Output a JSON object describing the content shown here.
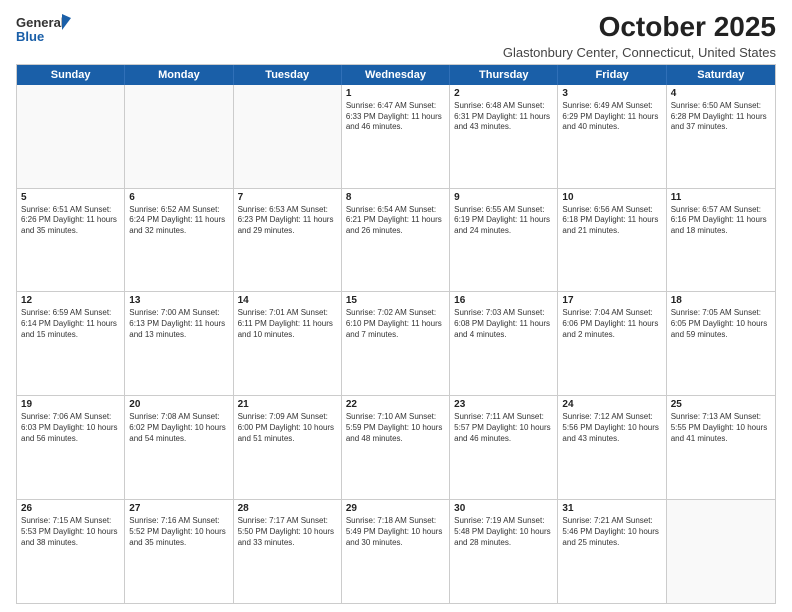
{
  "header": {
    "logo_general": "General",
    "logo_blue": "Blue",
    "month_title": "October 2025",
    "location": "Glastonbury Center, Connecticut, United States"
  },
  "days_of_week": [
    "Sunday",
    "Monday",
    "Tuesday",
    "Wednesday",
    "Thursday",
    "Friday",
    "Saturday"
  ],
  "weeks": [
    [
      {
        "day": "",
        "empty": true
      },
      {
        "day": "",
        "empty": true
      },
      {
        "day": "",
        "empty": true
      },
      {
        "day": "1",
        "info": "Sunrise: 6:47 AM\nSunset: 6:33 PM\nDaylight: 11 hours\nand 46 minutes."
      },
      {
        "day": "2",
        "info": "Sunrise: 6:48 AM\nSunset: 6:31 PM\nDaylight: 11 hours\nand 43 minutes."
      },
      {
        "day": "3",
        "info": "Sunrise: 6:49 AM\nSunset: 6:29 PM\nDaylight: 11 hours\nand 40 minutes."
      },
      {
        "day": "4",
        "info": "Sunrise: 6:50 AM\nSunset: 6:28 PM\nDaylight: 11 hours\nand 37 minutes."
      }
    ],
    [
      {
        "day": "5",
        "info": "Sunrise: 6:51 AM\nSunset: 6:26 PM\nDaylight: 11 hours\nand 35 minutes."
      },
      {
        "day": "6",
        "info": "Sunrise: 6:52 AM\nSunset: 6:24 PM\nDaylight: 11 hours\nand 32 minutes."
      },
      {
        "day": "7",
        "info": "Sunrise: 6:53 AM\nSunset: 6:23 PM\nDaylight: 11 hours\nand 29 minutes."
      },
      {
        "day": "8",
        "info": "Sunrise: 6:54 AM\nSunset: 6:21 PM\nDaylight: 11 hours\nand 26 minutes."
      },
      {
        "day": "9",
        "info": "Sunrise: 6:55 AM\nSunset: 6:19 PM\nDaylight: 11 hours\nand 24 minutes."
      },
      {
        "day": "10",
        "info": "Sunrise: 6:56 AM\nSunset: 6:18 PM\nDaylight: 11 hours\nand 21 minutes."
      },
      {
        "day": "11",
        "info": "Sunrise: 6:57 AM\nSunset: 6:16 PM\nDaylight: 11 hours\nand 18 minutes."
      }
    ],
    [
      {
        "day": "12",
        "info": "Sunrise: 6:59 AM\nSunset: 6:14 PM\nDaylight: 11 hours\nand 15 minutes."
      },
      {
        "day": "13",
        "info": "Sunrise: 7:00 AM\nSunset: 6:13 PM\nDaylight: 11 hours\nand 13 minutes."
      },
      {
        "day": "14",
        "info": "Sunrise: 7:01 AM\nSunset: 6:11 PM\nDaylight: 11 hours\nand 10 minutes."
      },
      {
        "day": "15",
        "info": "Sunrise: 7:02 AM\nSunset: 6:10 PM\nDaylight: 11 hours\nand 7 minutes."
      },
      {
        "day": "16",
        "info": "Sunrise: 7:03 AM\nSunset: 6:08 PM\nDaylight: 11 hours\nand 4 minutes."
      },
      {
        "day": "17",
        "info": "Sunrise: 7:04 AM\nSunset: 6:06 PM\nDaylight: 11 hours\nand 2 minutes."
      },
      {
        "day": "18",
        "info": "Sunrise: 7:05 AM\nSunset: 6:05 PM\nDaylight: 10 hours\nand 59 minutes."
      }
    ],
    [
      {
        "day": "19",
        "info": "Sunrise: 7:06 AM\nSunset: 6:03 PM\nDaylight: 10 hours\nand 56 minutes."
      },
      {
        "day": "20",
        "info": "Sunrise: 7:08 AM\nSunset: 6:02 PM\nDaylight: 10 hours\nand 54 minutes."
      },
      {
        "day": "21",
        "info": "Sunrise: 7:09 AM\nSunset: 6:00 PM\nDaylight: 10 hours\nand 51 minutes."
      },
      {
        "day": "22",
        "info": "Sunrise: 7:10 AM\nSunset: 5:59 PM\nDaylight: 10 hours\nand 48 minutes."
      },
      {
        "day": "23",
        "info": "Sunrise: 7:11 AM\nSunset: 5:57 PM\nDaylight: 10 hours\nand 46 minutes."
      },
      {
        "day": "24",
        "info": "Sunrise: 7:12 AM\nSunset: 5:56 PM\nDaylight: 10 hours\nand 43 minutes."
      },
      {
        "day": "25",
        "info": "Sunrise: 7:13 AM\nSunset: 5:55 PM\nDaylight: 10 hours\nand 41 minutes."
      }
    ],
    [
      {
        "day": "26",
        "info": "Sunrise: 7:15 AM\nSunset: 5:53 PM\nDaylight: 10 hours\nand 38 minutes."
      },
      {
        "day": "27",
        "info": "Sunrise: 7:16 AM\nSunset: 5:52 PM\nDaylight: 10 hours\nand 35 minutes."
      },
      {
        "day": "28",
        "info": "Sunrise: 7:17 AM\nSunset: 5:50 PM\nDaylight: 10 hours\nand 33 minutes."
      },
      {
        "day": "29",
        "info": "Sunrise: 7:18 AM\nSunset: 5:49 PM\nDaylight: 10 hours\nand 30 minutes."
      },
      {
        "day": "30",
        "info": "Sunrise: 7:19 AM\nSunset: 5:48 PM\nDaylight: 10 hours\nand 28 minutes."
      },
      {
        "day": "31",
        "info": "Sunrise: 7:21 AM\nSunset: 5:46 PM\nDaylight: 10 hours\nand 25 minutes."
      },
      {
        "day": "",
        "empty": true
      }
    ]
  ]
}
